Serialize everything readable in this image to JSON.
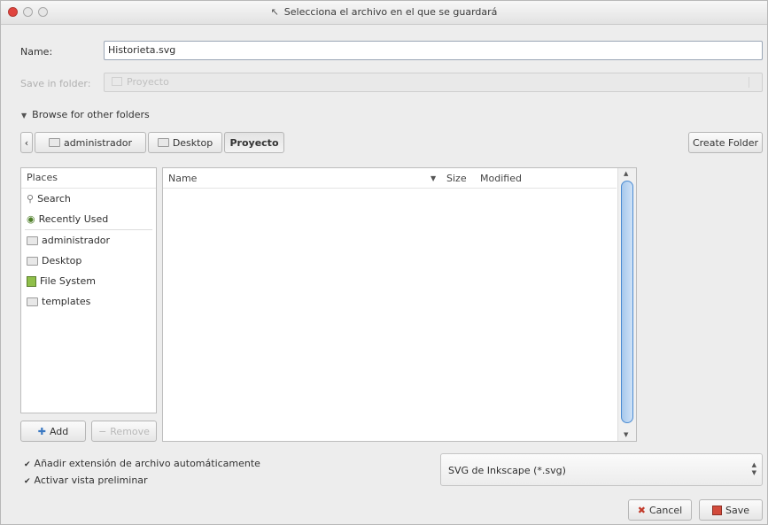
{
  "window": {
    "title": "Selecciona el archivo en el que se guardará"
  },
  "name_row": {
    "label": "Name:",
    "value": "Historieta.svg"
  },
  "save_in": {
    "label": "Save in folder:",
    "value": "Proyecto"
  },
  "browse": {
    "label": "Browse for other folders"
  },
  "path_bar": {
    "segments": [
      "administrador",
      "Desktop",
      "Proyecto"
    ],
    "create_folder_label": "Create Folder"
  },
  "places": {
    "header": "Places",
    "items": [
      {
        "label": "Search",
        "icon": "search-icon"
      },
      {
        "label": "Recently Used",
        "icon": "clock-icon"
      },
      {
        "label": "administrador",
        "icon": "folder-icon"
      },
      {
        "label": "Desktop",
        "icon": "folder-icon"
      },
      {
        "label": "File System",
        "icon": "drive-icon"
      },
      {
        "label": "templates",
        "icon": "folder-icon"
      }
    ],
    "add_label": "Add",
    "remove_label": "Remove"
  },
  "files": {
    "columns": [
      "Name",
      "Size",
      "Modified"
    ]
  },
  "options": {
    "auto_extension": "Añadir extensión de archivo automáticamente",
    "preview": "Activar vista preliminar"
  },
  "filter": {
    "value": "SVG de Inkscape (*.svg)"
  },
  "actions": {
    "cancel_label": "Cancel",
    "save_label": "Save"
  },
  "colors": {
    "close_button": "#e0443e",
    "scroll_thumb": "#4a8bd2"
  }
}
